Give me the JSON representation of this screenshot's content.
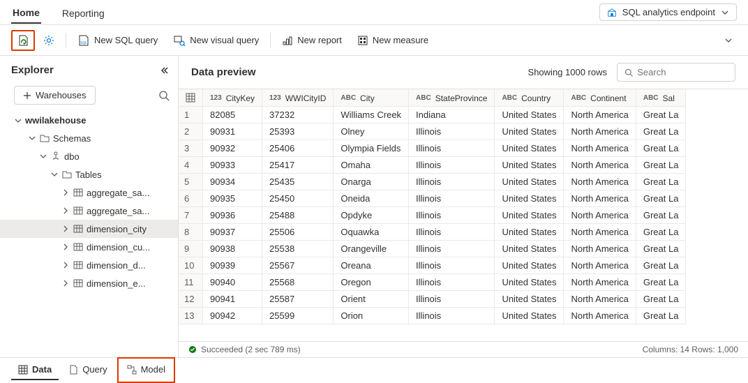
{
  "tabs": {
    "home": "Home",
    "reporting": "Reporting"
  },
  "mode": "SQL analytics endpoint",
  "toolbar": {
    "newSql": "New SQL query",
    "newVisual": "New visual query",
    "newReport": "New report",
    "newMeasure": "New measure"
  },
  "explorer": {
    "title": "Explorer",
    "warehouses": "Warehouses",
    "root": "wwilakehouse",
    "schemas": "Schemas",
    "dbo": "dbo",
    "tables": "Tables",
    "items": [
      "aggregate_sa...",
      "aggregate_sa...",
      "dimension_city",
      "dimension_cu...",
      "dimension_d...",
      "dimension_e..."
    ]
  },
  "preview": {
    "title": "Data preview",
    "showing": "Showing 1000 rows",
    "searchPlaceholder": "Search",
    "columns": [
      {
        "name": "CityKey",
        "type": "123"
      },
      {
        "name": "WWICityID",
        "type": "123"
      },
      {
        "name": "City",
        "type": "ABC"
      },
      {
        "name": "StateProvince",
        "type": "ABC"
      },
      {
        "name": "Country",
        "type": "ABC"
      },
      {
        "name": "Continent",
        "type": "ABC"
      },
      {
        "name": "Sal",
        "type": "ABC"
      }
    ],
    "rows": [
      [
        "82085",
        "37232",
        "Williams Creek",
        "Indiana",
        "United States",
        "North America",
        "Great La"
      ],
      [
        "90931",
        "25393",
        "Olney",
        "Illinois",
        "United States",
        "North America",
        "Great La"
      ],
      [
        "90932",
        "25406",
        "Olympia Fields",
        "Illinois",
        "United States",
        "North America",
        "Great La"
      ],
      [
        "90933",
        "25417",
        "Omaha",
        "Illinois",
        "United States",
        "North America",
        "Great La"
      ],
      [
        "90934",
        "25435",
        "Onarga",
        "Illinois",
        "United States",
        "North America",
        "Great La"
      ],
      [
        "90935",
        "25450",
        "Oneida",
        "Illinois",
        "United States",
        "North America",
        "Great La"
      ],
      [
        "90936",
        "25488",
        "Opdyke",
        "Illinois",
        "United States",
        "North America",
        "Great La"
      ],
      [
        "90937",
        "25506",
        "Oquawka",
        "Illinois",
        "United States",
        "North America",
        "Great La"
      ],
      [
        "90938",
        "25538",
        "Orangeville",
        "Illinois",
        "United States",
        "North America",
        "Great La"
      ],
      [
        "90939",
        "25567",
        "Oreana",
        "Illinois",
        "United States",
        "North America",
        "Great La"
      ],
      [
        "90940",
        "25568",
        "Oregon",
        "Illinois",
        "United States",
        "North America",
        "Great La"
      ],
      [
        "90941",
        "25587",
        "Orient",
        "Illinois",
        "United States",
        "North America",
        "Great La"
      ],
      [
        "90942",
        "25599",
        "Orion",
        "Illinois",
        "United States",
        "North America",
        "Great La"
      ]
    ],
    "status": "Succeeded (2 sec 789 ms)",
    "footer": "Columns: 14  Rows: 1,000"
  },
  "bottom": {
    "data": "Data",
    "query": "Query",
    "model": "Model"
  }
}
